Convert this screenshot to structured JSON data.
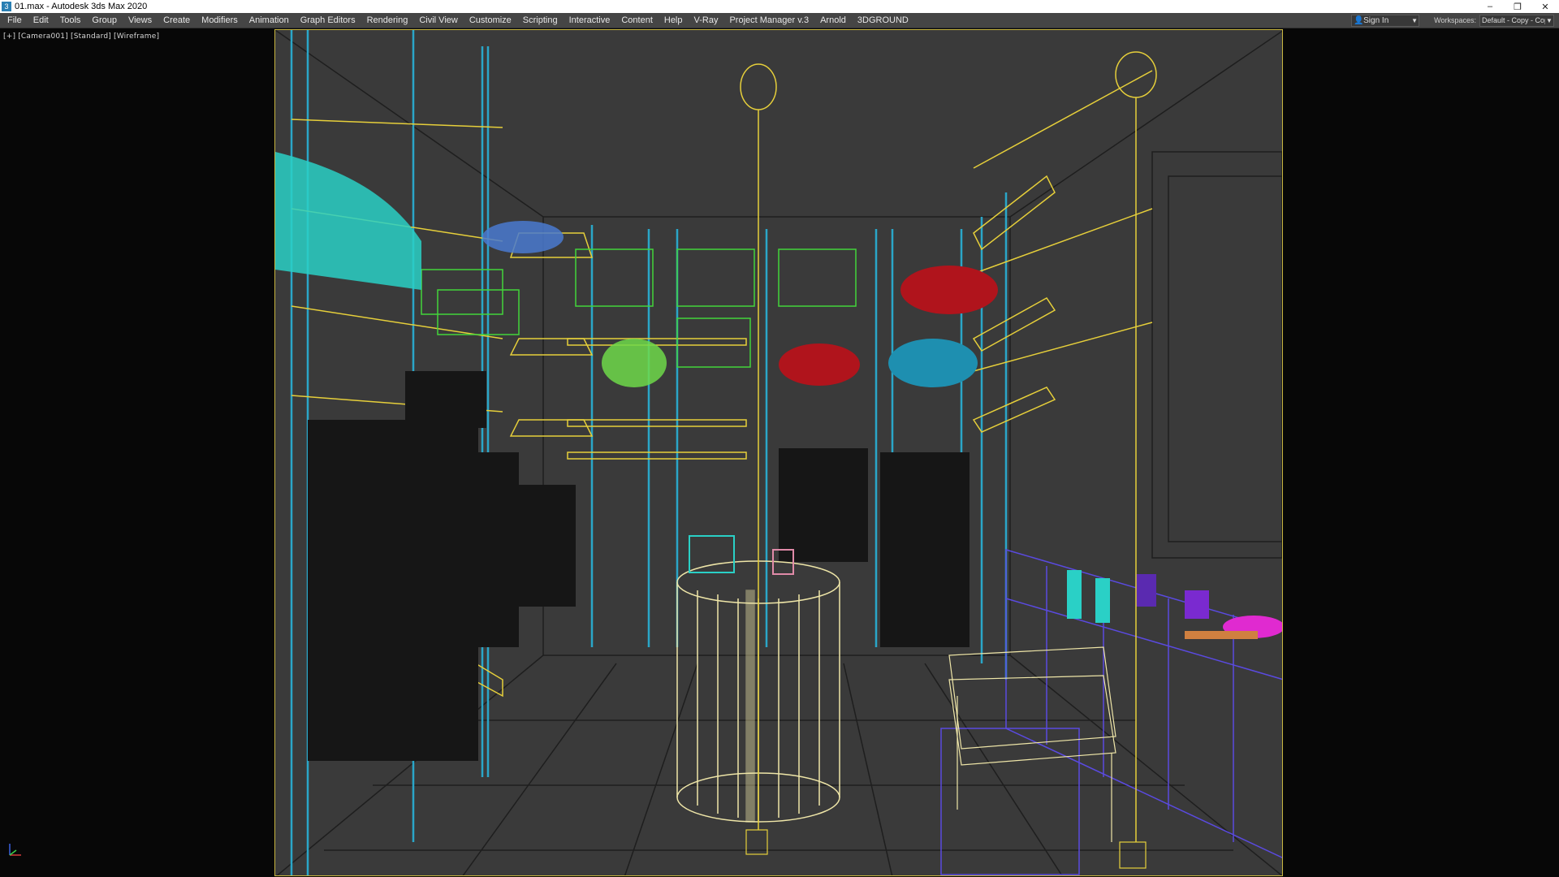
{
  "window": {
    "title": "01.max - Autodesk 3ds Max 2020",
    "icon": "3",
    "controls": {
      "minimize": "–",
      "maximize": "❐",
      "close": "✕"
    }
  },
  "menu": {
    "items": [
      "File",
      "Edit",
      "Tools",
      "Group",
      "Views",
      "Create",
      "Modifiers",
      "Animation",
      "Graph Editors",
      "Rendering",
      "Civil View",
      "Customize",
      "Scripting",
      "Interactive",
      "Content",
      "Help",
      "V-Ray",
      "Project Manager v.3",
      "Arnold",
      "3DGROUND"
    ],
    "sign_in": "Sign In",
    "workspaces_label": "Workspaces:",
    "workspace_value": "Default - Copy - Copy"
  },
  "viewport": {
    "label": "[+] [Camera001] [Standard] [Wireframe]",
    "background_color": "#3a3a3a",
    "frame_color": "#c8b640"
  },
  "colors": {
    "yellow_wire": "#e6cf3a",
    "teal_wire": "#2aa6c8",
    "gray_wire": "#1e1e1e",
    "green_wire": "#43d43b",
    "red_fill": "#b0141c",
    "cyan_fill": "#2ad0c6",
    "purple_wire": "#5a4ae0",
    "cream_wire": "#efe6a8"
  }
}
